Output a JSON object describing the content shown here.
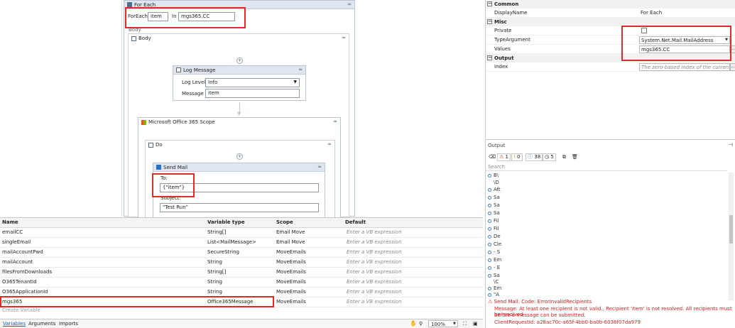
{
  "designer": {
    "for_each": {
      "title": "For Each",
      "foreach_label": "ForEach",
      "item_value": "item",
      "in_label": "In",
      "in_value": "mgs365.CC",
      "body_label": "Body"
    },
    "body_seq": {
      "title": "Body"
    },
    "log_message": {
      "title": "Log Message",
      "level_label": "Log Level",
      "level_value": "Info",
      "message_label": "Message",
      "message_value": "item"
    },
    "office_scope": {
      "title": "Microsoft Office 365 Scope"
    },
    "do_seq": {
      "title": "Do"
    },
    "send_mail": {
      "title": "Send Mail",
      "to_label": "To:",
      "to_value": "{\"item\"}",
      "subject_label": "Subject:",
      "subject_value": "\"Test Run\""
    }
  },
  "variables": {
    "headers": {
      "name": "Name",
      "type": "Variable type",
      "scope": "Scope",
      "default": "Default"
    },
    "rows": [
      {
        "name": "emailCC",
        "type": "String[]",
        "scope": "Email Move",
        "default": "Enter a VB expression"
      },
      {
        "name": "singleEmail",
        "type": "List<MailMessage>",
        "scope": "Email Move",
        "default": "Enter a VB expression"
      },
      {
        "name": "mailAccountPwd",
        "type": "SecureString",
        "scope": "MoveEmails",
        "default": "Enter a VB expression"
      },
      {
        "name": "mailAccount",
        "type": "String",
        "scope": "MoveEmails",
        "default": "Enter a VB expression"
      },
      {
        "name": "filesFromDownloads",
        "type": "String[]",
        "scope": "MoveEmails",
        "default": "Enter a VB expression"
      },
      {
        "name": "O365TenantId",
        "type": "String",
        "scope": "MoveEmails",
        "default": "Enter a VB expression"
      },
      {
        "name": "O365ApplicationId",
        "type": "String",
        "scope": "MoveEmails",
        "default": "Enter a VB expression"
      },
      {
        "name": "mgs365",
        "type": "Office365Message",
        "scope": "MoveEmails",
        "default": "Enter a VB expression"
      }
    ],
    "create_label": "Create Variable"
  },
  "bottom_tabs": {
    "variables": "Variables",
    "arguments": "Arguments",
    "imports": "Imports",
    "zoom": "100%"
  },
  "properties": {
    "common": {
      "title": "Common",
      "display_name_label": "DisplayName",
      "display_name_value": "For Each"
    },
    "misc": {
      "title": "Misc",
      "private_label": "Private",
      "type_arg_label": "TypeArgument",
      "type_arg_value": "System.Net.Mail.MailAddress",
      "values_label": "Values",
      "values_value": "mgs365.CC"
    },
    "output": {
      "title": "Output",
      "index_label": "Index",
      "index_placeholder": "The zero-based index of the current eleme"
    }
  },
  "output_panel": {
    "title": "Output",
    "counts": {
      "errors": "1",
      "warnings": "0",
      "info": "38",
      "trace": "5"
    },
    "search_placeholder": "Search",
    "lines": [
      "B\\",
      "\\D",
      "Aft",
      "Sa",
      "Sa",
      "Sa",
      "Fil",
      "Fil",
      "De",
      "Cle",
      "- S",
      "Em",
      "- E",
      "Sa",
      "\\C",
      "Em",
      "\"A"
    ],
    "error_title": "Send Mail: Code: ErrorInvalidRecipients",
    "error_message_1": "Message: At least one recipient is not valid., Recipient 'item' is not resolved. All recipients must be resolved",
    "error_message_2": "before a message can be submitted.",
    "error_request": "ClientRequestId: a28ac70c-a65f-4bb0-ba0b-6036f07da979"
  },
  "colors": {
    "highlight": "#e02b2b",
    "header": "#dfe6ef",
    "error": "#d42020"
  }
}
